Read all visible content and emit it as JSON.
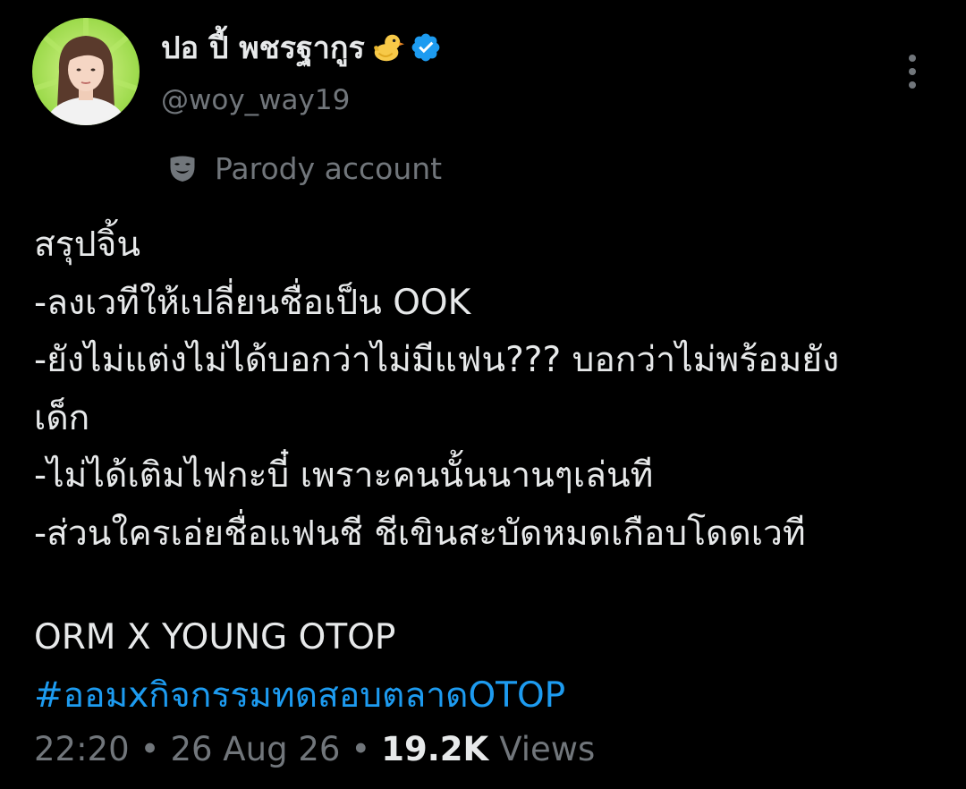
{
  "author": {
    "display_name": "ปอ ปี้ พชรฐากูร",
    "name_emoji": "🐤",
    "verified_icon": "verified-badge-icon",
    "handle": "@woy_way19",
    "avatar_bg": "#9be04a"
  },
  "menu": {
    "icon": "more-vertical-icon"
  },
  "label": {
    "icon": "mask-icon",
    "text": "Parody account"
  },
  "tweet": {
    "lines": [
      "สรุปจิ้น",
      "-ลงเวทีให้เปลี่ยนชื่อเป็น OOK",
      "-ยังไม่แต่งไม่ได้บอกว่าไม่มีแฟน??? บอกว่าไม่พร้อมยัง",
      "เด็ก",
      "-ไม่ได้เติมไฟกะบี๋ เพราะคนนั้นนานๆเล่นที",
      "-ส่วนใครเอ่ยชื่อแฟนชี ชีเขินสะบัดหมดเกือบโดดเวที"
    ],
    "tagline": "ORM X YOUNG OTOP",
    "hashtag": "#ออมxกิจกรรมทดสอบตลาดOTOP"
  },
  "meta": {
    "time": "22:20",
    "separator": "•",
    "date": "26 Aug 26",
    "views_count": "19.2K",
    "views_label": "Views"
  },
  "colors": {
    "background": "#000000",
    "text": "#e7e9ea",
    "secondary": "#71767b",
    "link": "#1d9bf0",
    "verified": "#1d9bf0"
  }
}
